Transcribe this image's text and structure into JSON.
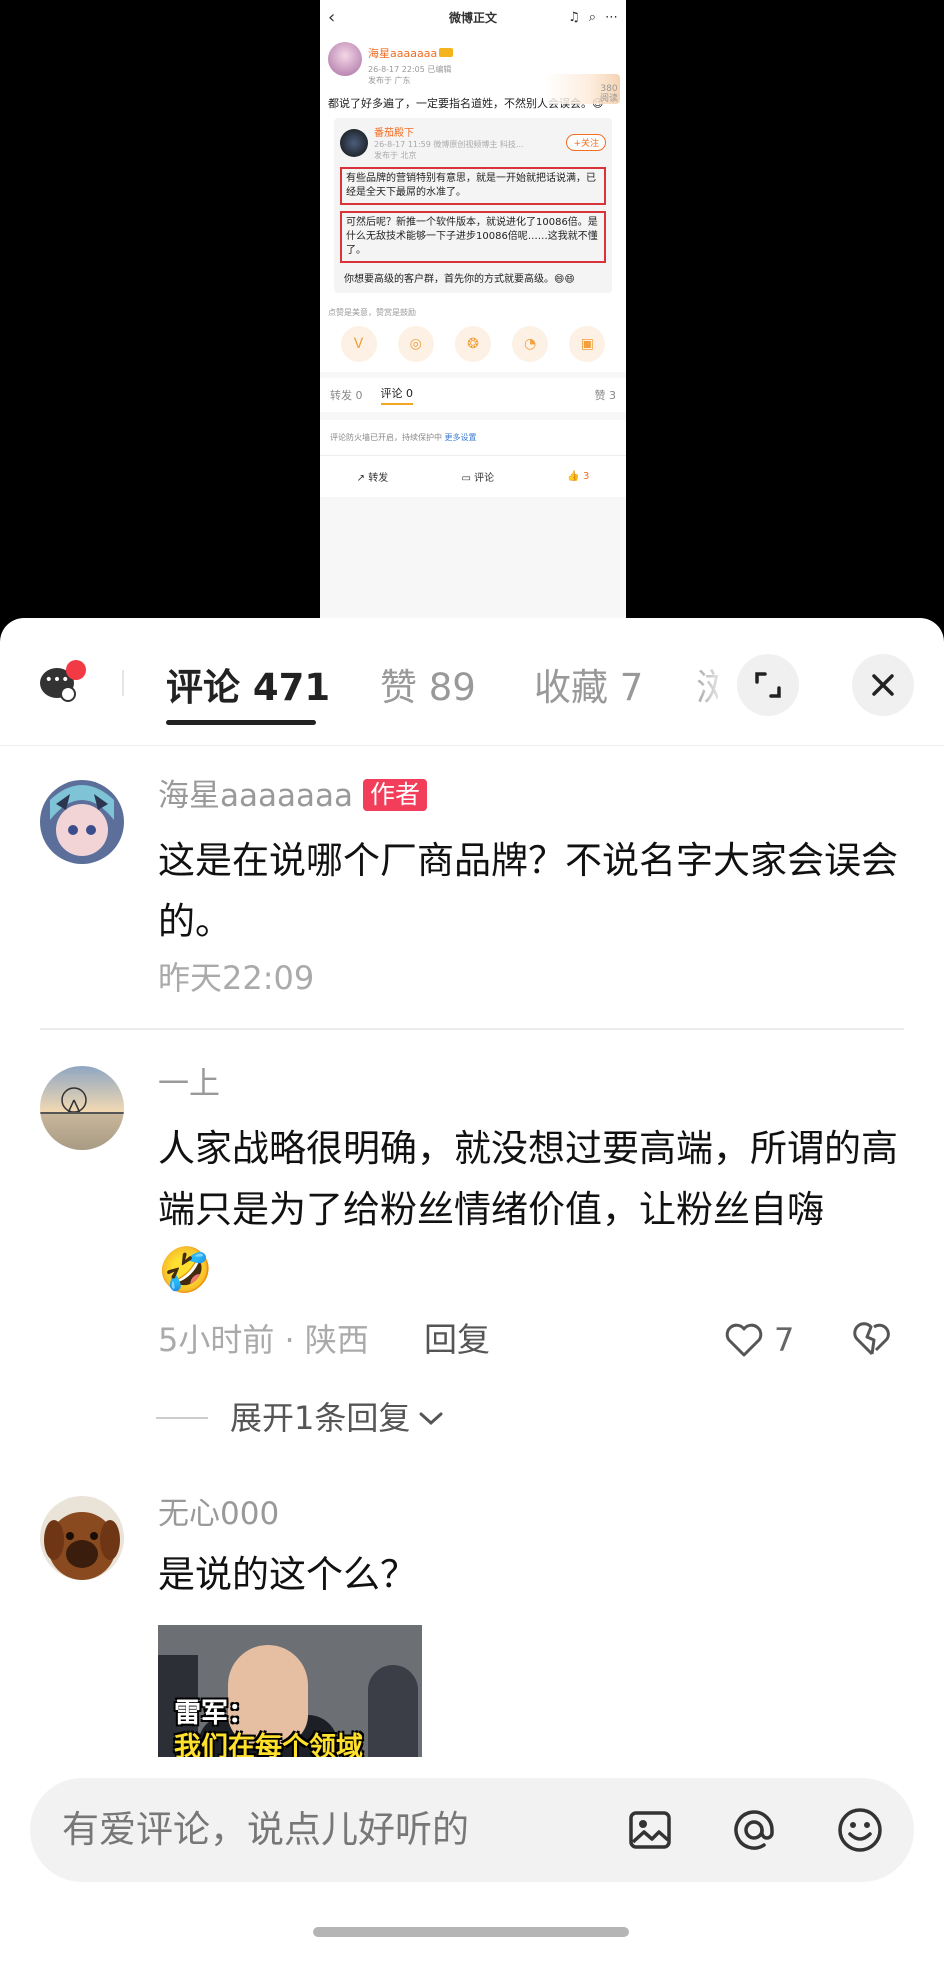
{
  "embedded_post": {
    "nav_title": "微博正文",
    "author": "海星aaaaaaa",
    "author_level": "8",
    "meta_time": "26-8-17 22:05",
    "meta_edit": "已编辑",
    "meta_location": "发布于 广东",
    "views": "380",
    "views_label": "阅读",
    "text": "都说了好多遍了，一定要指名道姓，不然别人会误会。😉",
    "repost": {
      "author": "番茄殿下",
      "meta": "26-8-17 11:59 微博原创视频博主 科技...",
      "meta2": "发布于 北京",
      "follow": "+关注",
      "boxed1": "有些品牌的营销特别有意思，就是一开始就把话说满，已经是全天下最屌的水准了。",
      "boxed2": "可然后呢？新推一个软件版本，就说进化了10086倍。是什么无敌技术能够一下子进步10086倍呢……这我就不懂了。",
      "plain": "你想要高级的客户群，首先你的方式就要高级。😄😄"
    },
    "tip": "点赞是美意，赞赏是鼓励",
    "tabs": {
      "repost": "转发 0",
      "comment": "评论 0",
      "like": "赞 3"
    },
    "safe": "评论防火墙已开启，持续保护中",
    "safe_link": "更多设置",
    "bottom": {
      "repost": "转发",
      "comment": "评论",
      "like": "3"
    }
  },
  "tabs": {
    "comments": "评论 471",
    "likes": "赞 89",
    "favorites": "收藏 7",
    "more": "浏"
  },
  "comments": [
    {
      "user": "海星aaaaaaa",
      "badge": "作者",
      "text": "这是在说哪个厂商品牌？不说名字大家会误会的。",
      "time": "昨天22:09"
    },
    {
      "user": "一上",
      "text": "人家战略很明确，就没想过要高端，所谓的高端只是为了给粉丝情绪价值，让粉丝自嗨",
      "emoji": "🤣",
      "time": "5小时前 · 陕西",
      "reply": "回复",
      "likes": "7",
      "expand": "展开1条回复"
    },
    {
      "user": "无心000",
      "text": "是说的这个么？",
      "meme_caption1": "雷军：",
      "meme_caption2": "我们在每个领域"
    }
  ],
  "input": {
    "placeholder": "有爱评论，说点儿好听的"
  }
}
